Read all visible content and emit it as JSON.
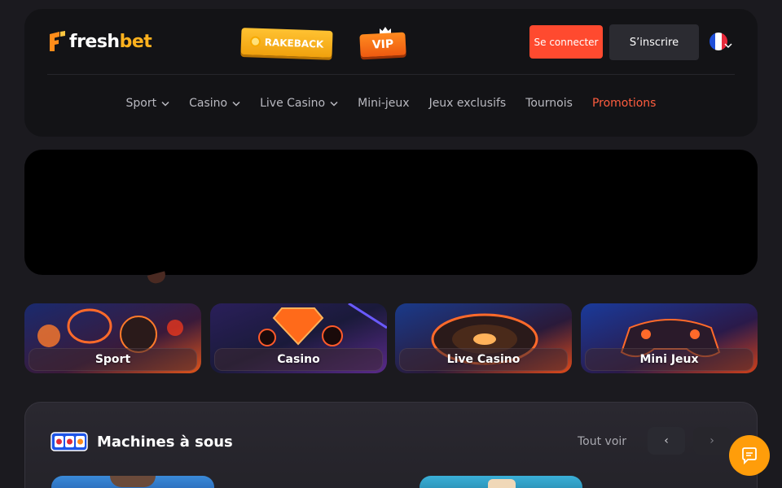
{
  "header": {
    "logo": {
      "text_main": "fresh",
      "text_accent": "bet"
    },
    "rakeback_label": "RAKEBACK",
    "vip_label": "VIP",
    "login_label": "Se connecter",
    "signup_label": "S’inscrire",
    "language": "fr"
  },
  "nav": {
    "items": [
      {
        "label": "Sport",
        "has_dropdown": true
      },
      {
        "label": "Casino",
        "has_dropdown": true
      },
      {
        "label": "Live Casino",
        "has_dropdown": true
      },
      {
        "label": "Mini-jeux",
        "has_dropdown": false
      },
      {
        "label": "Jeux exclusifs",
        "has_dropdown": false
      },
      {
        "label": "Tournois",
        "has_dropdown": false
      },
      {
        "label": "Promotions",
        "has_dropdown": false,
        "active": true
      }
    ]
  },
  "categories": [
    {
      "label": "Sport"
    },
    {
      "label": "Casino"
    },
    {
      "label": "Live Casino"
    },
    {
      "label": "Mini Jeux"
    }
  ],
  "slots_section": {
    "title": "Machines à sous",
    "see_all_label": "Tout voir",
    "prev_icon": "‹",
    "next_icon": "›"
  },
  "colors": {
    "accent": "#ff4a2f",
    "brand_yellow": "#ffb21e",
    "active_nav": "#ff5d3f",
    "chat": "#ff9d0a"
  },
  "icons": [
    "chevron-down-icon",
    "crown-icon",
    "coin-icon",
    "flag-fr-icon",
    "slot-machine-icon",
    "chat-icon"
  ]
}
